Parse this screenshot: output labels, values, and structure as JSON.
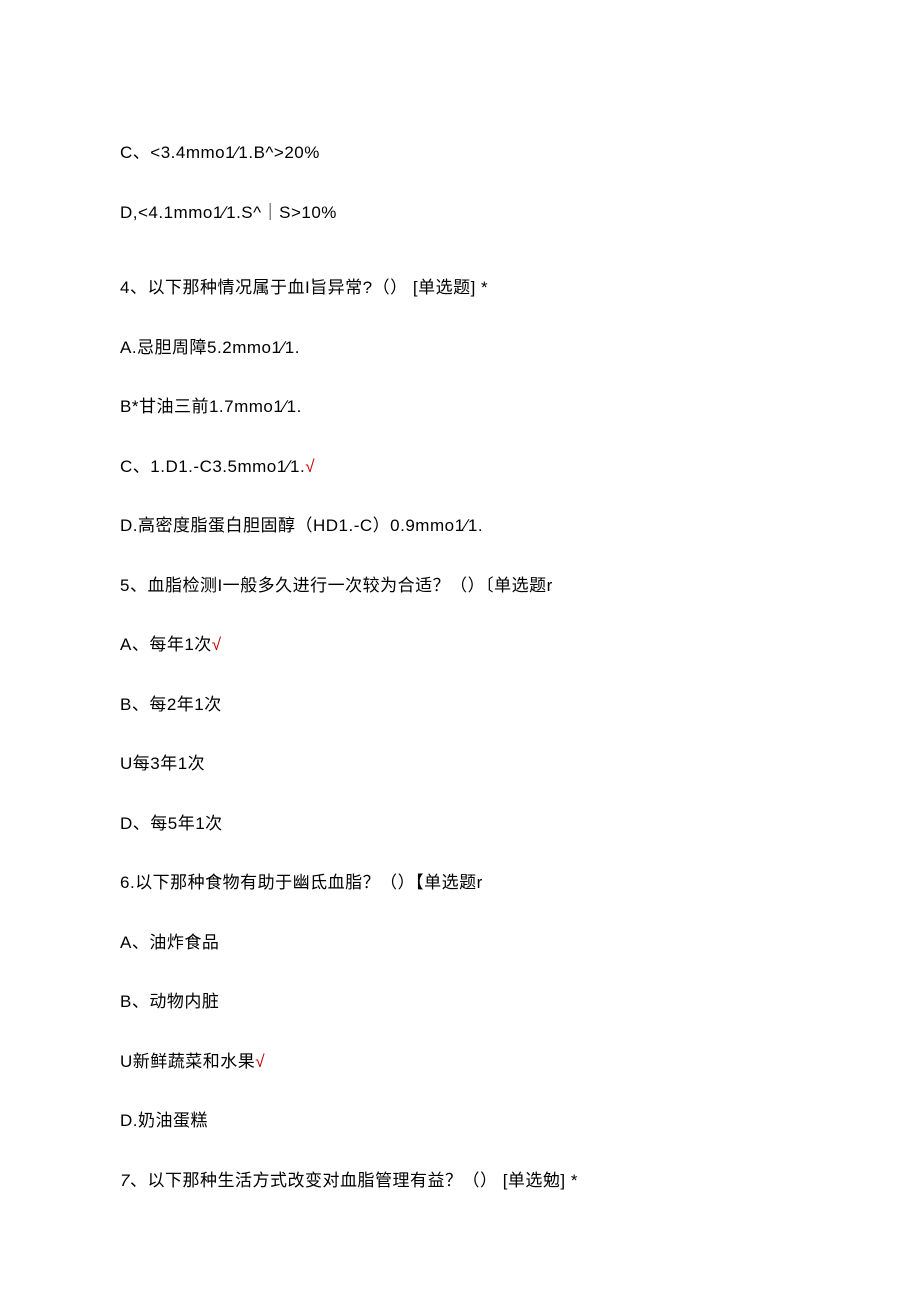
{
  "lines": {
    "q3_optC": "C、<3.4mmo1∕1.B^>20%",
    "q3_optD": "D,<4.1mmo1∕1.S^｜S>10%",
    "q4_stem": "4、以下那种情况属于血I旨异常?（）  [单选题]  *",
    "q4_optA": "A.忌胆周障5.2mmo1∕1.",
    "q4_optB": "B*甘油三前1.7mmo1∕1.",
    "q4_optC_text": "C、1.D1.-C3.5mmo1∕1.",
    "q4_optC_check": "√",
    "q4_optD": "D.高密度脂蛋白胆固醇（HD1.-C）0.9mmo1∕1.",
    "q5_stem": "5、血脂检测I一般多久进行一次较为合适？（）〔单选题r",
    "q5_optA_text": "A、每年1次",
    "q5_optA_check": "√",
    "q5_optB": "B、每2年1次",
    "q5_optC": "U每3年1次",
    "q5_optD": "D、每5年1次",
    "q6_stem": "6.以下那种食物有助于幽氐血脂？（）【单选题r",
    "q6_optA": "A、油炸食品",
    "q6_optB": "B、动物内脏",
    "q6_optC_text": "U新鲜蔬菜和水果",
    "q6_optC_check": "√",
    "q6_optD": "D.奶油蛋糕",
    "q7_num": "7",
    "q7_stem_rest": "、以下那种生活方式改变对血脂管理有益？（）  [单选勉]  *"
  }
}
